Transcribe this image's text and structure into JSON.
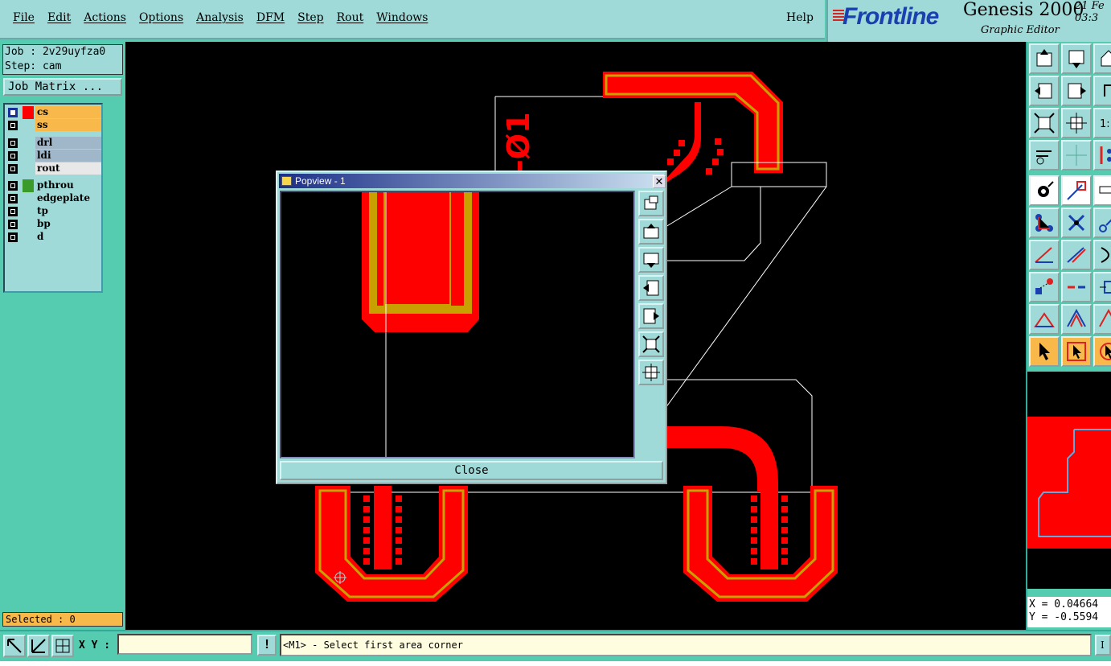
{
  "menu": {
    "items": [
      "File",
      "Edit",
      "Actions",
      "Options",
      "Analysis",
      "DFM",
      "Step",
      "Rout",
      "Windows"
    ],
    "help": "Help"
  },
  "brand": {
    "logo": "Frontline",
    "product": "Genesis 2000",
    "subtitle": "Graphic Editor",
    "date_line1": "21 Fe",
    "date_line2": "03:3"
  },
  "job": {
    "job_line": "Job : 2v29uyfza0",
    "step_line": "Step: cam",
    "matrix_button": "Job Matrix ..."
  },
  "layers": {
    "group1": [
      {
        "name": "cs",
        "color": "#ff0000",
        "bg": "#f9b84a",
        "checked": true
      },
      {
        "name": "ss",
        "color": "#000000",
        "bg": "#f9b84a",
        "checked": false
      }
    ],
    "group2": [
      {
        "name": "drl",
        "color": "#000000",
        "bg": "#9fb7c8",
        "checked": false
      },
      {
        "name": "ldi",
        "color": "#000000",
        "bg": "#9fb7c8",
        "checked": false
      },
      {
        "name": "rout",
        "color": "#000000",
        "bg": "#e8e8e8",
        "checked": false
      }
    ],
    "group3": [
      {
        "name": "pthrou",
        "color": "#3a9b2a",
        "bg": "#9fdad8",
        "checked": false
      },
      {
        "name": "edgeplate",
        "color": "#000000",
        "bg": "#9fdad8",
        "checked": false
      },
      {
        "name": "tp",
        "color": "#000000",
        "bg": "#9fdad8",
        "checked": false
      },
      {
        "name": "bp",
        "color": "#000000",
        "bg": "#9fdad8",
        "checked": false
      },
      {
        "name": "d",
        "color": "#000000",
        "bg": "#9fdad8",
        "checked": false
      }
    ]
  },
  "selected": "Selected : 0",
  "canvas": {
    "rotated_text": "-Ø1",
    "copper_color": "#ff0000",
    "outline_color": "#c8a000"
  },
  "popview": {
    "title": "Popview - 1",
    "close_label": "Close",
    "title_close": "✕"
  },
  "coords": {
    "x": "X = 0.04664",
    "y": "Y = -0.5594"
  },
  "bottom": {
    "xy_label": "X Y :",
    "xy_value": "",
    "excl": "!",
    "status": "<M1> - Select first area corner",
    "right_label": "I"
  }
}
